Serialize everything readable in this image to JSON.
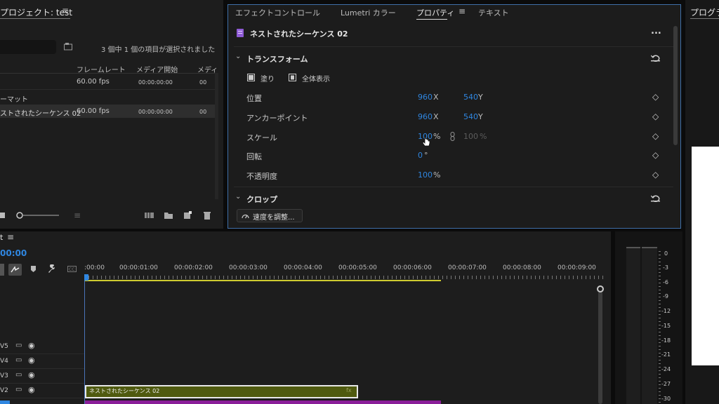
{
  "project": {
    "title": "プロジェクト: test",
    "selection_info": "3 個中 1 個の項目が選択されました",
    "columns": [
      "フレームレート",
      "メディア開始",
      "メディ"
    ],
    "rows": [
      {
        "name": "",
        "fps": "60.00 fps",
        "start": "00:00:00:00",
        "extra": "00"
      },
      {
        "name": "ーマット",
        "fps": "",
        "start": "",
        "extra": ""
      },
      {
        "name": "ストされたシーケンス 02",
        "fps": "60.00 fps",
        "start": "00:00:00:00",
        "extra": "00"
      }
    ]
  },
  "effects_panel": {
    "tabs": [
      "エフェクトコントロール",
      "Lumetri カラー",
      "プロパティ",
      "テキスト"
    ],
    "active_tab": "プロパティ",
    "clip_name": "ネストされたシーケンス 02",
    "more": "...",
    "transform_title": "トランスフォーム",
    "fill_label": "塗り",
    "show_all_label": "全体表示",
    "properties": [
      {
        "label": "位置",
        "v1": "960",
        "u1": "X",
        "v2": "540",
        "u2": "Y"
      },
      {
        "label": "アンカーポイント",
        "v1": "960",
        "u1": "X",
        "v2": "540",
        "u2": "Y"
      },
      {
        "label": "スケール",
        "v1": "100",
        "u1": "%",
        "v2": "100",
        "u2": "%"
      },
      {
        "label": "回転",
        "v1": "0",
        "u1": "°",
        "v2": "",
        "u2": ""
      },
      {
        "label": "不透明度",
        "v1": "100",
        "u1": "%",
        "v2": "",
        "u2": ""
      }
    ],
    "crop_title": "クロップ",
    "speed_button": "速度を調整..."
  },
  "program_title": "プログラ",
  "timeline": {
    "title": "t",
    "timecode": "00:00",
    "ruler": [
      ":00:00",
      "00:00:01:00",
      "00:00:02:00",
      "00:00:03:00",
      "00:00:04:00",
      "00:00:05:00",
      "00:00:06:00",
      "00:00:07:00",
      "00:00:08:00",
      "00:00:09:00"
    ],
    "tracks": [
      "V5",
      "V4",
      "V3",
      "V2"
    ],
    "clip_label": "ネストされたシーケンス 02",
    "clip_fx": "fx"
  },
  "meter": {
    "scale": [
      "0",
      "-3",
      "-6",
      "-9",
      "-12",
      "-15",
      "-18",
      "-21",
      "-24",
      "-27",
      "-30"
    ]
  },
  "colors": {
    "accent_blue": "#2f86e0",
    "clip_green": "#4f5a0f",
    "clip_purple": "#8a1e99",
    "work_area": "#cfcb30"
  }
}
